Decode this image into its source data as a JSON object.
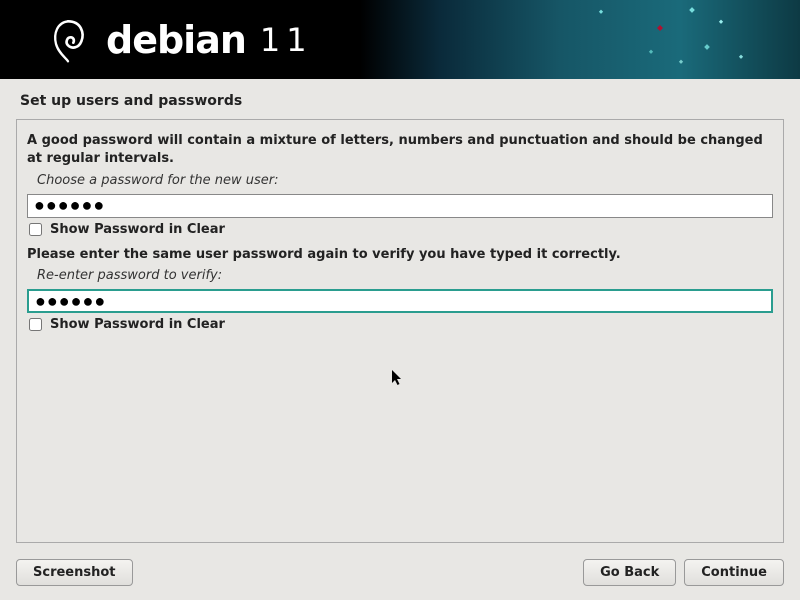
{
  "header": {
    "brand": "debian",
    "version": "11"
  },
  "page_title": "Set up users and passwords",
  "instruction": "A good password will contain a mixture of letters, numbers and punctuation and should be changed at regular intervals.",
  "password1": {
    "label": "Choose a password for the new user:",
    "value_mask": "●●●●●●",
    "show_clear_label": "Show Password in Clear",
    "show_clear_checked": false
  },
  "verify_instruction": "Please enter the same user password again to verify you have typed it correctly.",
  "password2": {
    "label": "Re-enter password to verify:",
    "value_mask": "●●●●●●",
    "show_clear_label": "Show Password in Clear",
    "show_clear_checked": false
  },
  "buttons": {
    "screenshot": "Screenshot",
    "go_back": "Go Back",
    "continue": "Continue"
  }
}
